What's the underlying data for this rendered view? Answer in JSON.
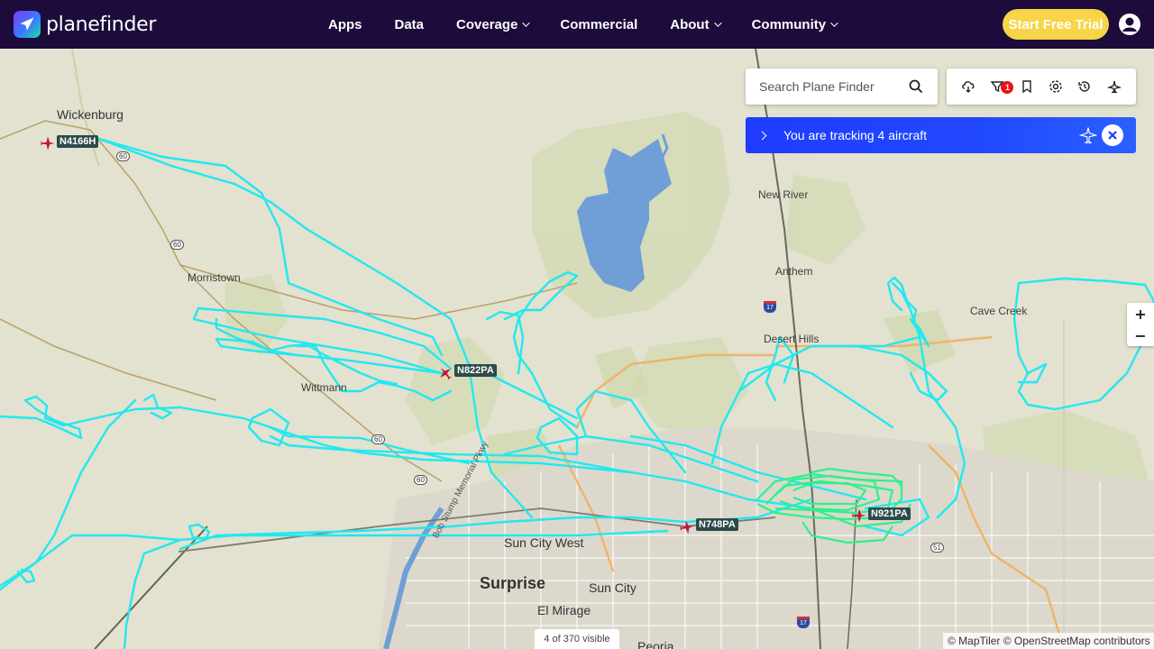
{
  "app": {
    "name": "planefinder",
    "nav": [
      {
        "label": "Apps",
        "dropdown": false
      },
      {
        "label": "Data",
        "dropdown": false
      },
      {
        "label": "Coverage",
        "dropdown": true
      },
      {
        "label": "Commercial",
        "dropdown": false
      },
      {
        "label": "About",
        "dropdown": true
      },
      {
        "label": "Community",
        "dropdown": true
      }
    ],
    "trial_label": "Start Free Trial"
  },
  "search": {
    "placeholder": "Search Plane Finder"
  },
  "toolbar": {
    "tools": [
      "weather-icon",
      "filter-icon",
      "bookmark-icon",
      "settings-icon",
      "history-icon",
      "playback-icon"
    ],
    "filter_badge": "1"
  },
  "tracking": {
    "text": "You are tracking 4 aircraft"
  },
  "zoom": {
    "in": "+",
    "out": "−"
  },
  "status": {
    "visible": "4 of 370 visible"
  },
  "attribution": "© MapTiler © OpenStreetMap contributors",
  "aircraft": [
    {
      "callsign": "N4166H"
    },
    {
      "callsign": "N822PA"
    },
    {
      "callsign": "N748PA"
    },
    {
      "callsign": "N921PA"
    }
  ],
  "places": [
    "Wickenburg",
    "Morristown",
    "Wittmann",
    "New River",
    "Anthem",
    "Desert Hills",
    "Cave Creek",
    "Sun City West",
    "Surprise",
    "Sun City",
    "El Mirage",
    "Peoria"
  ],
  "road_label": "Bob Stump Memorial Pkwy",
  "shields": [
    "60",
    "60",
    "60",
    "60",
    "51"
  ],
  "interstates": [
    "17",
    "17"
  ],
  "colors": {
    "nav_bg": "#1c0b3b",
    "trial": "#f7d448",
    "track_cyan": "#22e8f0",
    "track_green": "#2ff08a",
    "tracking_bar": "#1f3cff",
    "aircraft": "#c4173a"
  }
}
